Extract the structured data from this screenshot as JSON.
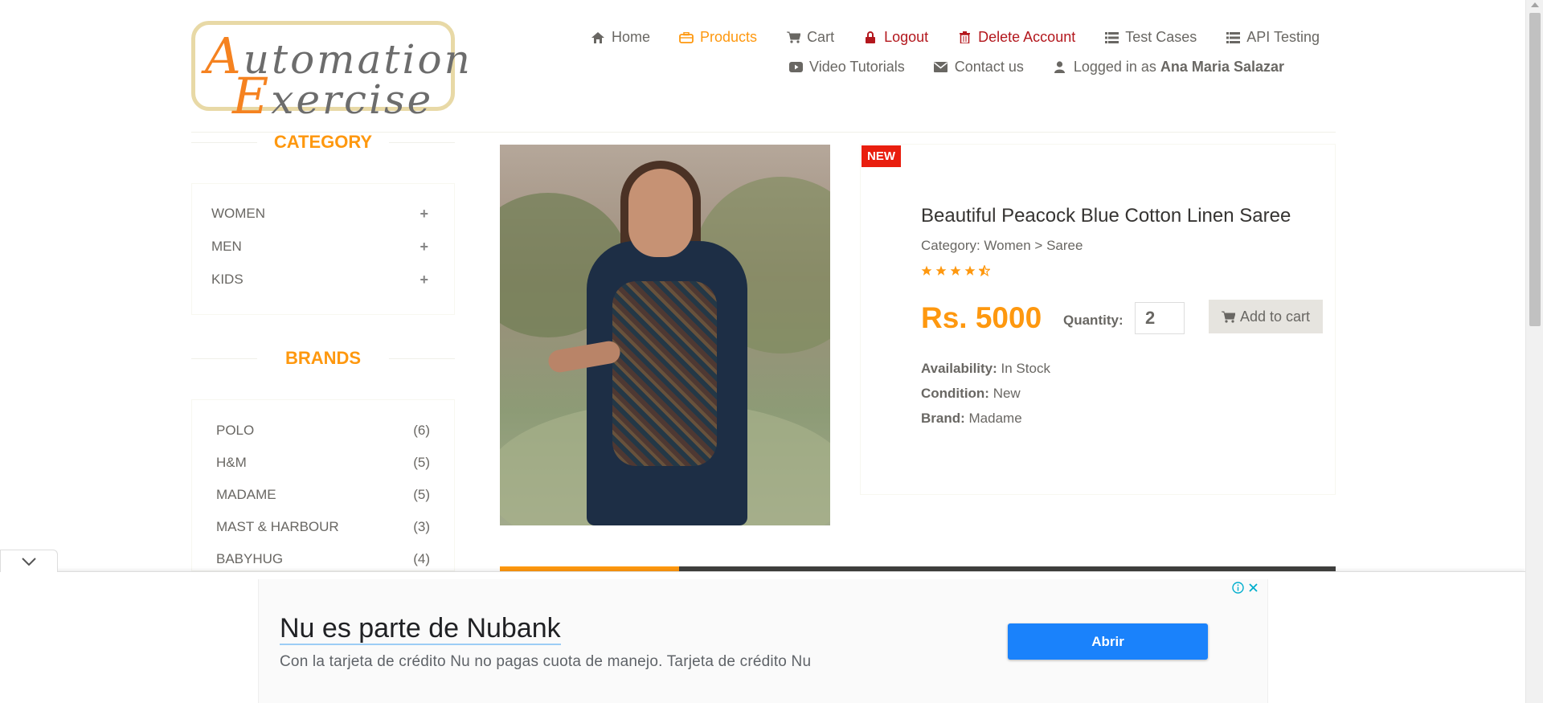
{
  "logo": {
    "line1_cap": "A",
    "line1_rest": "utomation",
    "line2_cap": "E",
    "line2_rest": "xercise"
  },
  "nav": {
    "row1": [
      {
        "label": "Home",
        "icon": "home-icon"
      },
      {
        "label": "Products",
        "icon": "briefcase-icon",
        "active": true
      },
      {
        "label": "Cart",
        "icon": "cart-icon"
      },
      {
        "label": "Logout",
        "icon": "lock-icon"
      },
      {
        "label": "Delete Account",
        "icon": "trash-icon"
      },
      {
        "label": "Test Cases",
        "icon": "list-icon"
      },
      {
        "label": "API Testing",
        "icon": "list-icon"
      }
    ],
    "row2": [
      {
        "label": "Video Tutorials",
        "icon": "youtube-icon"
      },
      {
        "label": "Contact us",
        "icon": "envelope-icon"
      },
      {
        "label": "Logged in as",
        "icon": "user-icon",
        "user": "Ana Maria Salazar"
      }
    ]
  },
  "sidebar": {
    "category_title": "CATEGORY",
    "categories": [
      "WOMEN",
      "MEN",
      "KIDS"
    ],
    "brands_title": "BRANDS",
    "brands": [
      {
        "name": "POLO",
        "count": "(6)"
      },
      {
        "name": "H&M",
        "count": "(5)"
      },
      {
        "name": "MADAME",
        "count": "(5)"
      },
      {
        "name": "MAST & HARBOUR",
        "count": "(3)"
      },
      {
        "name": "BABYHUG",
        "count": "(4)"
      }
    ]
  },
  "product": {
    "badge": "NEW",
    "name": "Beautiful Peacock Blue Cotton Linen Saree",
    "category": "Category: Women > Saree",
    "rating": 4.5,
    "price": "Rs. 5000",
    "quantity_label": "Quantity:",
    "quantity_value": "2",
    "add_to_cart": "Add to cart",
    "availability_label": "Availability:",
    "availability": "In Stock",
    "condition_label": "Condition:",
    "condition": "New",
    "brand_label": "Brand:",
    "brand": "Madame"
  },
  "ad": {
    "title": "Nu es parte de Nubank",
    "description": "Con la tarjeta de crédito Nu no pagas cuota de manejo. Tarjeta de crédito Nu",
    "button": "Abrir"
  },
  "colors": {
    "accent": "#fe980f",
    "text": "#696763",
    "danger": "#b3171d",
    "ad_button": "#1a82fb"
  }
}
